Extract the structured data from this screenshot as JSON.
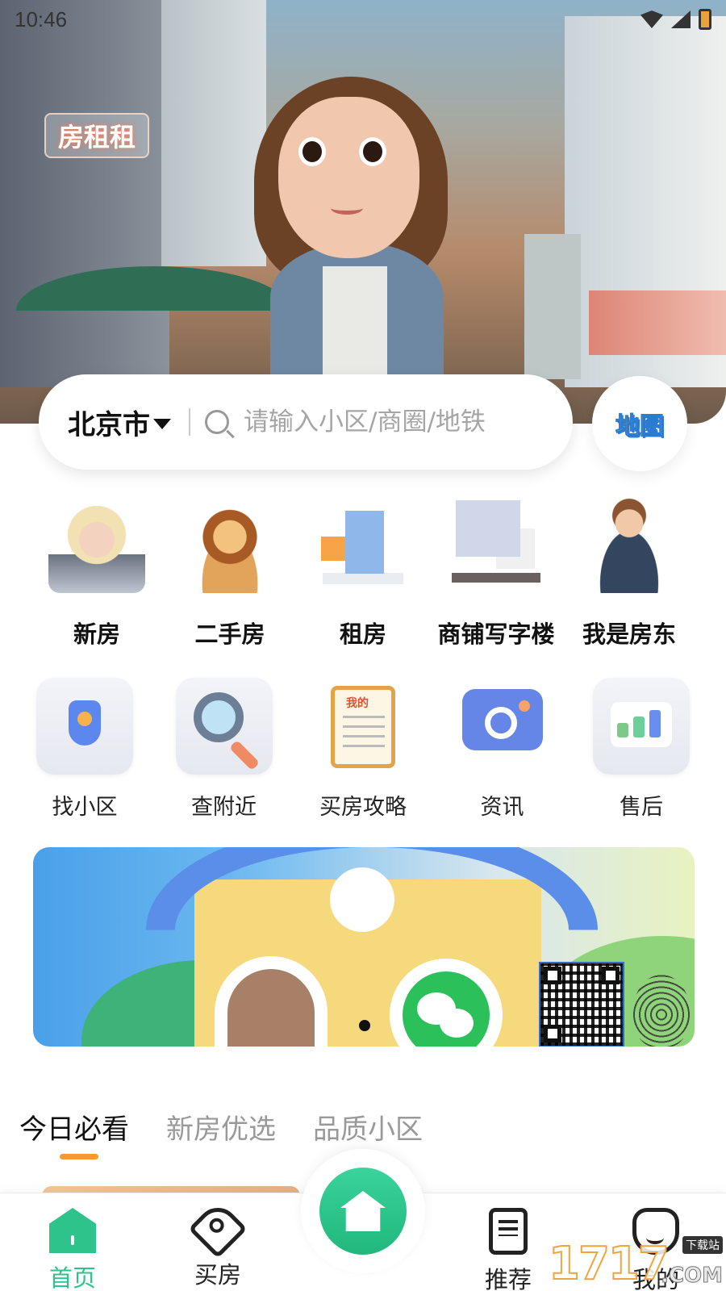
{
  "status_bar": {
    "time": "10:46"
  },
  "hero": {
    "sign_text": "房租租"
  },
  "search": {
    "city": "北京市",
    "placeholder": "请输入小区/商圈/地铁"
  },
  "map_button": {
    "label": "地图"
  },
  "categories_primary": [
    {
      "label": "新房",
      "icon": "princess-avatar-icon"
    },
    {
      "label": "二手房",
      "icon": "lion-icon"
    },
    {
      "label": "租房",
      "icon": "building-icon"
    },
    {
      "label": "商铺写字楼",
      "icon": "shop-office-icon"
    },
    {
      "label": "我是房东",
      "icon": "landlord-icon"
    }
  ],
  "categories_secondary": [
    {
      "label": "找小区",
      "icon": "shield-icon"
    },
    {
      "label": "查附近",
      "icon": "magnifier-icon"
    },
    {
      "label": "买房攻略",
      "icon": "notepad-icon",
      "badge": "我的"
    },
    {
      "label": "资讯",
      "icon": "chat-bubble-icon"
    },
    {
      "label": "售后",
      "icon": "bar-chart-icon"
    }
  ],
  "tabs": [
    {
      "label": "今日必看",
      "active": true
    },
    {
      "label": "新房优选",
      "active": false
    },
    {
      "label": "品质小区",
      "active": false
    }
  ],
  "bottom_nav": [
    {
      "label": "首页",
      "icon": "home-icon",
      "active": true
    },
    {
      "label": "买房",
      "icon": "tag-icon",
      "active": false
    },
    {
      "label": "推荐",
      "icon": "document-icon",
      "active": false
    },
    {
      "label": "我的",
      "icon": "face-icon",
      "active": false
    }
  ],
  "watermark": {
    "number": "1717",
    "tag": "下载站",
    "suffix": ".COM"
  },
  "colors": {
    "accent": "#2fc38c",
    "tab_indicator": "#f79a33",
    "inactive_tab": "#999999"
  }
}
